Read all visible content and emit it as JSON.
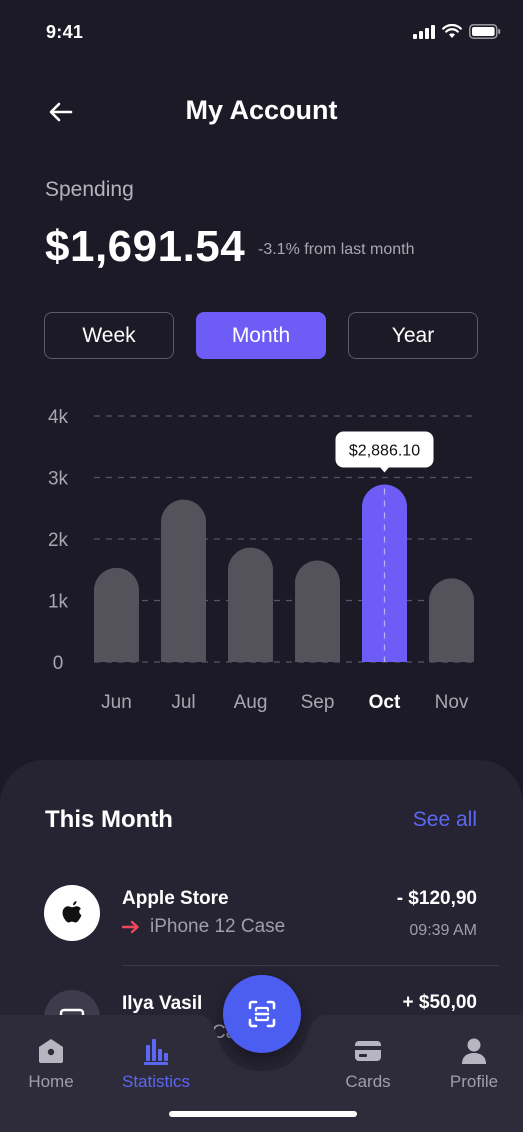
{
  "status_bar": {
    "time": "9:41"
  },
  "header": {
    "title": "My Account"
  },
  "spending": {
    "label": "Spending",
    "amount": "$1,691.54",
    "change": "-3.1% from last month"
  },
  "period_tabs": [
    {
      "label": "Week",
      "active": false
    },
    {
      "label": "Month",
      "active": true
    },
    {
      "label": "Year",
      "active": false
    }
  ],
  "chart_data": {
    "type": "bar",
    "categories": [
      "Jun",
      "Jul",
      "Aug",
      "Sep",
      "Oct",
      "Nov"
    ],
    "values": [
      1530,
      2640,
      1860,
      1650,
      2886.1,
      1360
    ],
    "ylim": [
      0,
      4000
    ],
    "yticks": [
      "0",
      "1k",
      "2k",
      "3k",
      "4k"
    ],
    "ytick_values": [
      0,
      1000,
      2000,
      3000,
      4000
    ],
    "highlight_index": 4,
    "highlight_label": "$2,886.10",
    "grid": true,
    "colors": {
      "bar": "#54535c",
      "highlight": "#6e5cf6",
      "grid": "#55546a",
      "axis_text": "#a8a7b1"
    }
  },
  "this_month": {
    "title": "This Month",
    "see_all": "See all",
    "transactions": [
      {
        "icon": "apple-icon",
        "name": "Apple Store",
        "sub": "iPhone 12 Case",
        "amount": "- $120,90",
        "time": "09:39 AM"
      },
      {
        "icon": "card-icon",
        "name": "Ilya Vasil",
        "sub": "Ca",
        "amount": "+ $50,00",
        "time": ""
      }
    ]
  },
  "nav": {
    "items": [
      {
        "label": "Home",
        "icon": "home-icon",
        "active": false
      },
      {
        "label": "Statistics",
        "icon": "statistics-icon",
        "active": true
      },
      {
        "label": "Cards",
        "icon": "cards-icon",
        "active": false
      },
      {
        "label": "Profile",
        "icon": "profile-icon",
        "active": false
      }
    ],
    "fab_icon": "scan-icon"
  },
  "colors": {
    "accent": "#6e5cf6",
    "link": "#5c67f2",
    "background": "#1c1a26",
    "sheet": "#262433"
  }
}
